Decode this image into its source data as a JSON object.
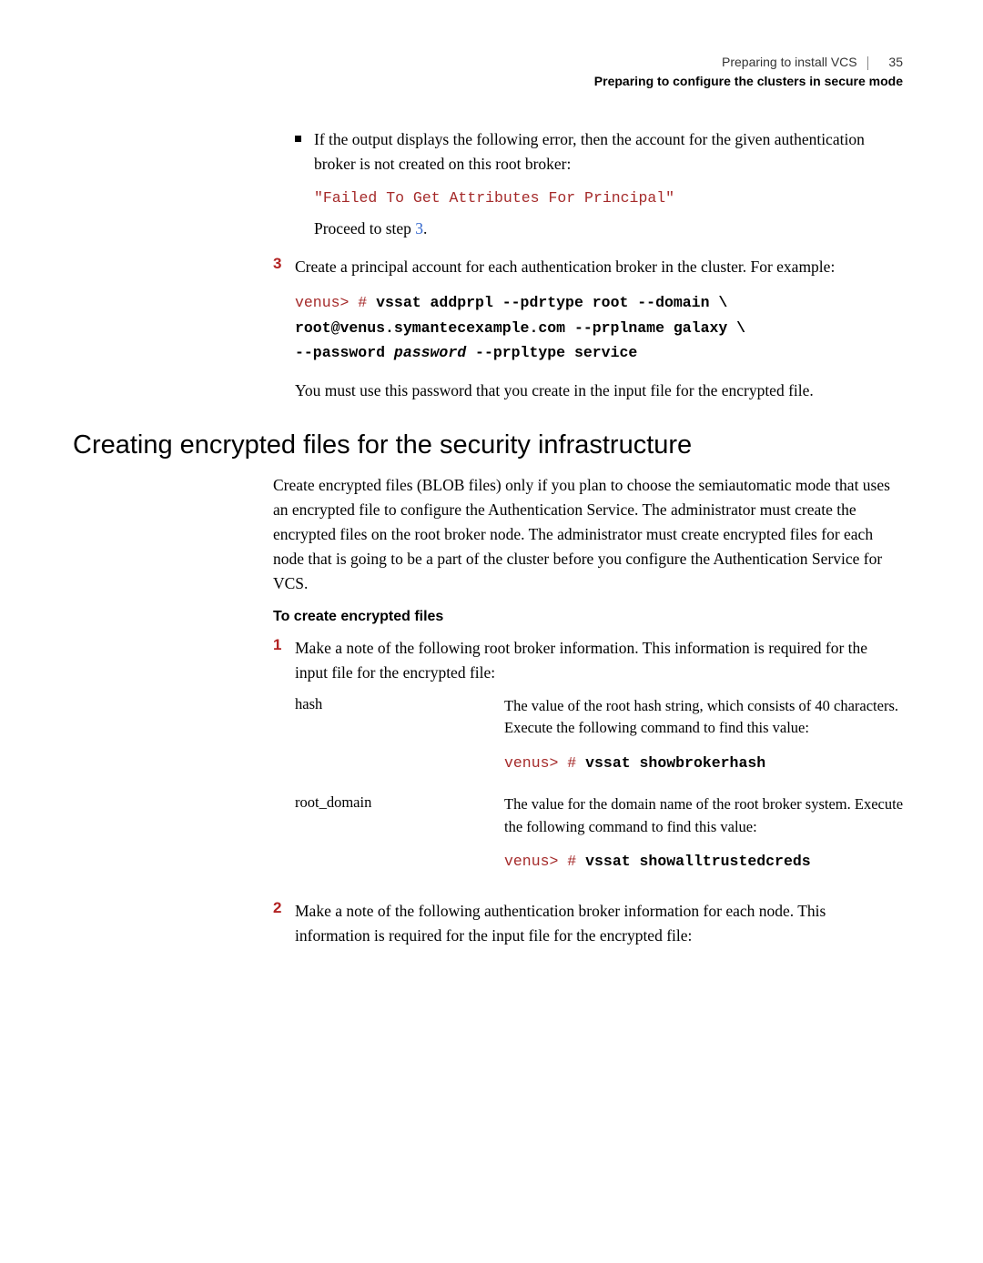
{
  "header": {
    "chapter": "Preparing to install VCS",
    "page": "35",
    "section": "Preparing to configure the clusters in secure mode"
  },
  "bullet1": {
    "text": "If the output displays the following error, then the account for the given authentication broker is not created on this root broker:",
    "code": "\"Failed To Get Attributes For Principal\"",
    "proceed_prefix": "Proceed to step ",
    "proceed_link": "3",
    "proceed_suffix": "."
  },
  "step3": {
    "num": "3",
    "text": "Create a principal account for each authentication broker in the cluster. For example:",
    "code_prefix": "venus> # ",
    "code_l1": "vssat addprpl --pdrtype root --domain \\",
    "code_l2": "root@venus.symantecexample.com --prplname galaxy \\",
    "code_l3a": "--password ",
    "code_l3b": "password",
    "code_l3c": " --prpltype service",
    "after": "You must use this password that you create in the input file for the encrypted file."
  },
  "h2": "Creating encrypted files for the security infrastructure",
  "intro": "Create encrypted files (BLOB files) only if you plan to choose the semiautomatic mode that uses an encrypted file to configure the Authentication Service. The administrator must create the encrypted files on the root broker node. The administrator must create encrypted files for each node that is going to be a part of the cluster before you configure the Authentication Service for VCS.",
  "sub": "To create encrypted files",
  "step1": {
    "num": "1",
    "text": "Make a note of the following root broker information. This information is required for the input file for the encrypted file:"
  },
  "row1": {
    "key": "hash",
    "desc": "The value of the root hash string, which consists of 40 characters. Execute the following command to find this value:",
    "code_prefix": "venus> # ",
    "code": "vssat showbrokerhash"
  },
  "row2": {
    "key": "root_domain",
    "desc": "The value for the domain name of the root broker system. Execute the following command to find this value:",
    "code_prefix": "venus> # ",
    "code": "vssat showalltrustedcreds"
  },
  "step2": {
    "num": "2",
    "text": "Make a note of the following authentication broker information for each node. This information is required for the input file for the encrypted file:"
  }
}
